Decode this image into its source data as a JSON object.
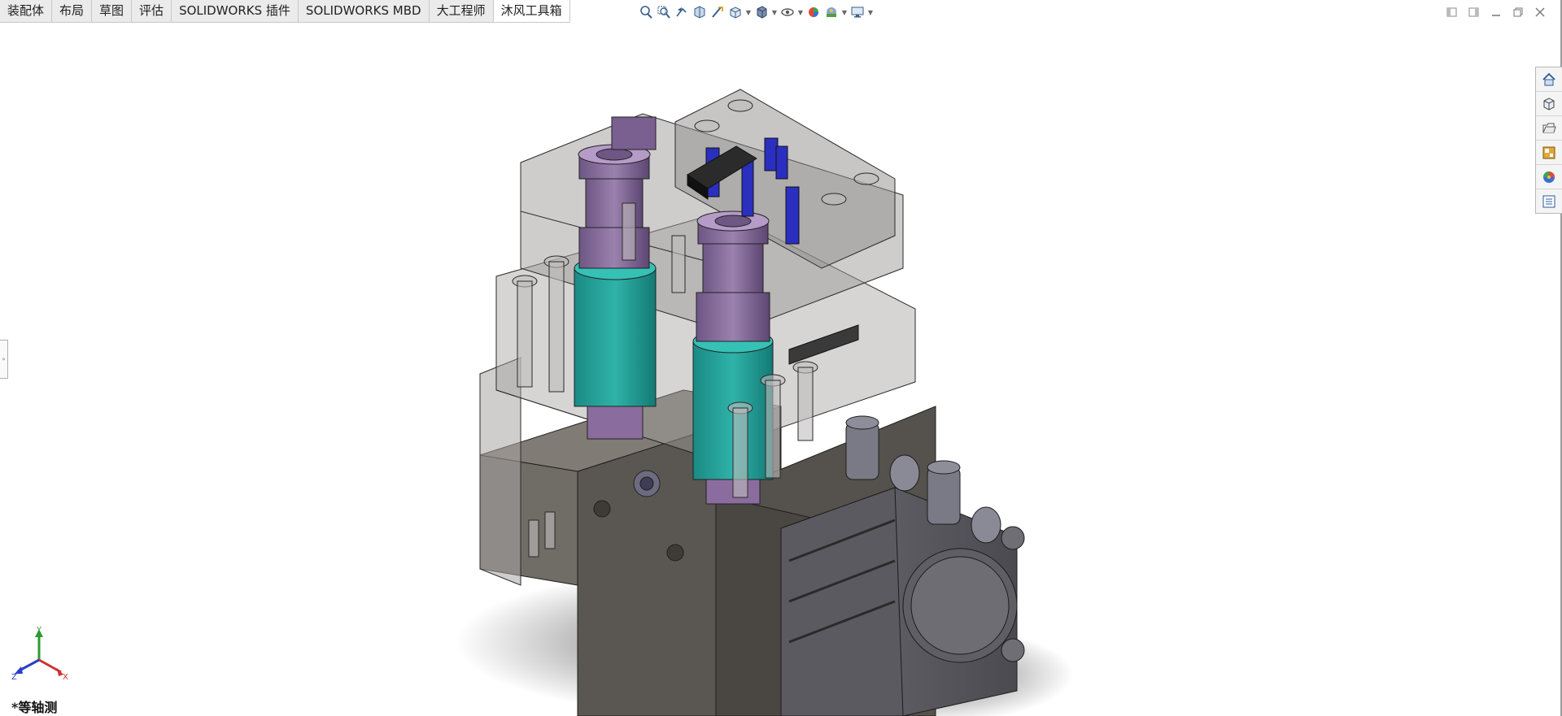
{
  "tabs": [
    {
      "label": "装配体",
      "active": false
    },
    {
      "label": "布局",
      "active": false
    },
    {
      "label": "草图",
      "active": false
    },
    {
      "label": "评估",
      "active": false
    },
    {
      "label": "SOLIDWORKS 插件",
      "active": false
    },
    {
      "label": "SOLIDWORKS MBD",
      "active": false
    },
    {
      "label": "大工程师",
      "active": false
    },
    {
      "label": "沐风工具箱",
      "active": true
    }
  ],
  "view_toolbar": {
    "icons": [
      "zoom-to-fit-icon",
      "zoom-to-area-icon",
      "previous-view-icon",
      "section-view-icon",
      "dynamic-annotation-icon",
      "view-orientation-icon",
      "display-style-icon",
      "hide-show-items-icon",
      "edit-appearance-icon",
      "apply-scene-icon",
      "view-settings-icon"
    ]
  },
  "window_controls": [
    "tile-left-icon",
    "tile-right-icon",
    "minimize-icon",
    "restore-icon",
    "close-icon"
  ],
  "task_pane": [
    "solidworks-resources-icon",
    "design-library-icon",
    "file-explorer-icon",
    "view-palette-icon",
    "appearances-icon",
    "custom-properties-icon"
  ],
  "triad": {
    "x": "X",
    "y": "Y",
    "z": "Z"
  },
  "view_name": "*等轴测",
  "colors": {
    "cylinder_teal": "#23a39a",
    "cylinder_purple": "#8a6d9e",
    "blue_parts": "#2a2fbf",
    "body_gray": "#5d5a55",
    "glass": "#9e9c9c"
  }
}
